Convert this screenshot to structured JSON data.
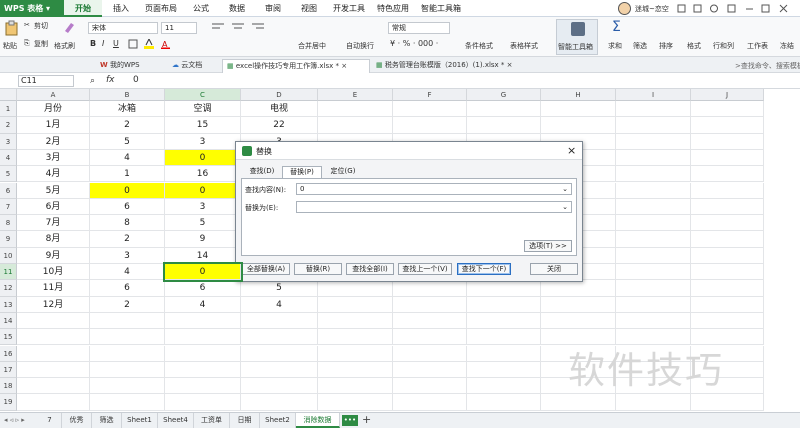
{
  "app": {
    "name": "WPS 表格",
    "active_menu": "开始"
  },
  "menu_tabs": [
    "开始",
    "插入",
    "页面布局",
    "公式",
    "数据",
    "审阅",
    "视图",
    "开发工具",
    "特色应用",
    "智能工具箱"
  ],
  "user": {
    "name": "迷城~恋空"
  },
  "ribbon": {
    "paste": "粘贴",
    "cut": "剪切",
    "copy": "复制",
    "format_painter": "格式刷",
    "font_name": "宋体",
    "font_size": "11",
    "bold": "B",
    "italic": "I",
    "underline": "U",
    "merge_center": "合并居中",
    "wrap_text": "自动换行",
    "number_format": "常规",
    "cond_format": "条件格式",
    "table_style": "表格样式",
    "smart_toolbox": "智能工具箱",
    "sum": "求和",
    "filter": "筛选",
    "sort": "排序",
    "format": "格式",
    "row_col": "行和列",
    "worksheet": "工作表",
    "freeze": "冻结"
  },
  "doc_tabs": [
    {
      "label": "我的WPS"
    },
    {
      "label": "云文档"
    },
    {
      "label": "excel操作技巧专用工作簿.xlsx *"
    },
    {
      "label": "税务管理台账模版（2016）(1).xlsx *"
    }
  ],
  "search_placeholder": ">查找命令、搜索模板",
  "formula_bar": {
    "cell_ref": "C11",
    "fx": "fx",
    "value": "0"
  },
  "columns": [
    "A",
    "B",
    "C",
    "D",
    "E",
    "F",
    "G",
    "H",
    "I",
    "J"
  ],
  "rows": [
    [
      "月份",
      "冰箱",
      "空调",
      "电视"
    ],
    [
      "1月",
      "2",
      "15",
      "22"
    ],
    [
      "2月",
      "5",
      "3",
      "3"
    ],
    [
      "3月",
      "4",
      "0",
      ""
    ],
    [
      "4月",
      "1",
      "16",
      ""
    ],
    [
      "5月",
      "0",
      "0",
      ""
    ],
    [
      "6月",
      "6",
      "3",
      ""
    ],
    [
      "7月",
      "8",
      "5",
      ""
    ],
    [
      "8月",
      "2",
      "9",
      ""
    ],
    [
      "9月",
      "3",
      "14",
      ""
    ],
    [
      "10月",
      "4",
      "0",
      ""
    ],
    [
      "11月",
      "6",
      "6",
      "5"
    ],
    [
      "12月",
      "2",
      "4",
      "4"
    ]
  ],
  "row_numbers": [
    "1",
    "2",
    "3",
    "4",
    "5",
    "6",
    "7",
    "8",
    "9",
    "10",
    "11",
    "12",
    "13",
    "14",
    "15",
    "16",
    "17",
    "18",
    "19"
  ],
  "highlight_color": "#ffff00",
  "dialog": {
    "title": "替换",
    "tabs": [
      "查找(D)",
      "替换(P)",
      "定位(G)"
    ],
    "find_label": "查找内容(N):",
    "find_value": "0",
    "replace_label": "替换为(E):",
    "replace_value": "",
    "options_button": "选项(T) >>",
    "buttons": [
      "全部替换(A)",
      "替换(R)",
      "查找全部(I)",
      "查找上一个(V)",
      "查找下一个(F)",
      "关闭"
    ]
  },
  "sheet_tabs": [
    "7",
    "优秀",
    "筛选",
    "Sheet1",
    "Sheet4",
    "工资单",
    "日期",
    "Sheet2",
    "消除数据"
  ],
  "active_sheet": "消除数据",
  "watermark": "软件技巧"
}
